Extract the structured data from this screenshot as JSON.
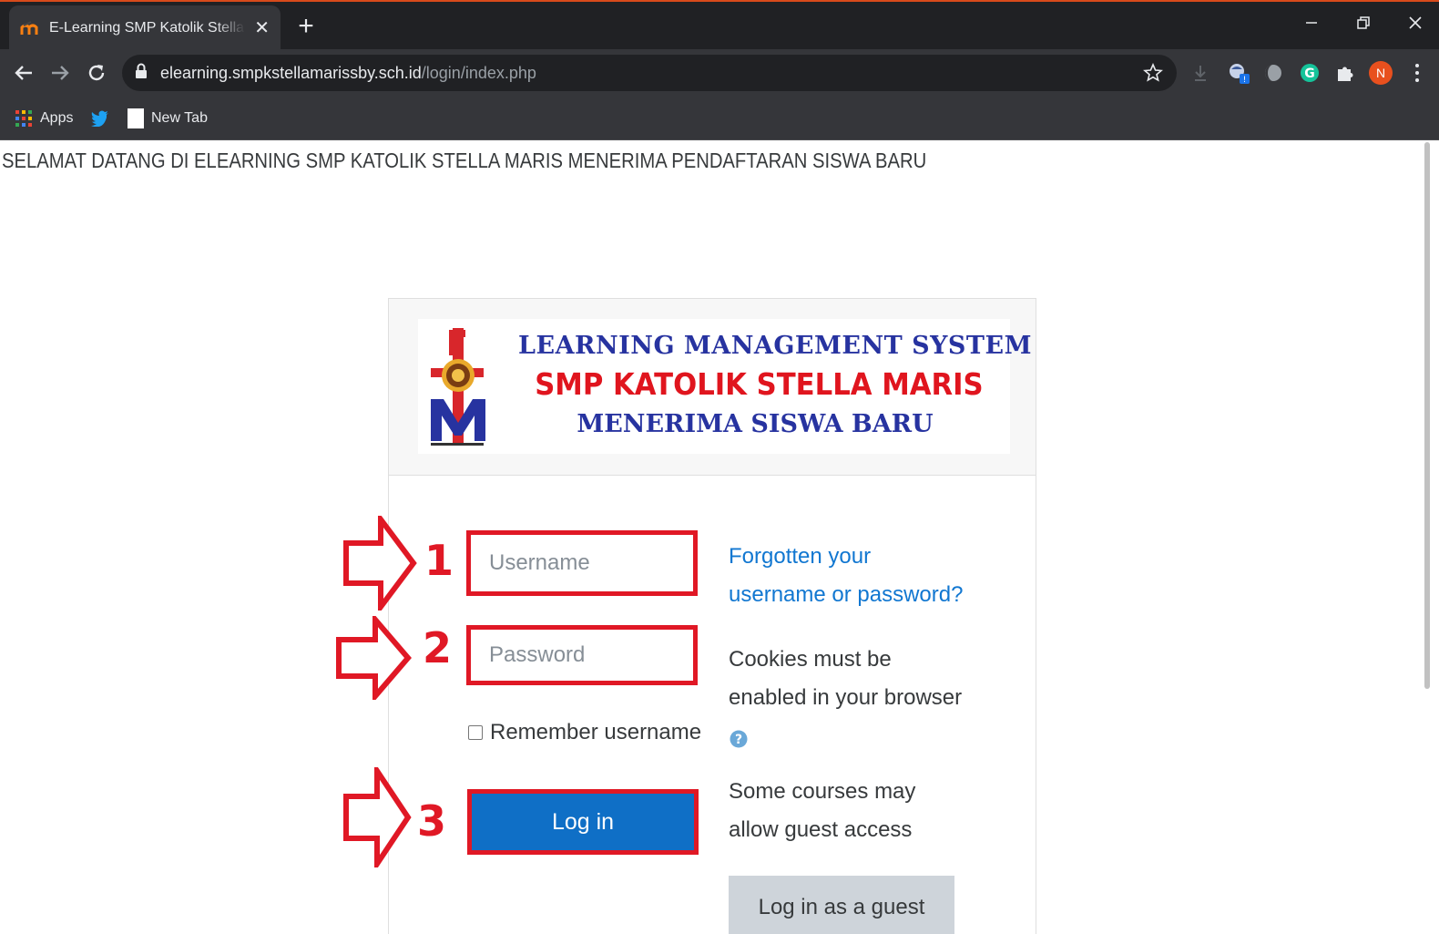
{
  "browser": {
    "tab_title": "E-Learning SMP Katolik Stella Maris",
    "tab_close": "✕",
    "new_tab": "+",
    "url_host": "elearning.smpkstellamarissby.sch.id",
    "url_path": "/login/index.php",
    "bookmarks": [
      {
        "label": "Apps",
        "icon": "apps-grid-icon"
      },
      {
        "label": "",
        "icon": "twitter-icon"
      },
      {
        "label": "New Tab",
        "icon": "page-icon"
      }
    ],
    "profile_initial": "N",
    "colors": {
      "frame": "#202124",
      "toolbar": "#35363a",
      "accent": "#d84a1b"
    }
  },
  "page": {
    "welcome_text": "SELAMAT DATANG DI ELEARNING SMP KATOLIK STELLA MARIS MENERIMA PENDAFTARAN SISWA BARU"
  },
  "banner": {
    "line1": "LEARNING MANAGEMENT SYSTEM",
    "line2": "SMP KATOLIK STELLA MARIS",
    "line3": "MENERIMA SISWA BARU",
    "colors": {
      "blue": "#2733a0",
      "red": "#e0151e"
    }
  },
  "login": {
    "username_placeholder": "Username",
    "password_placeholder": "Password",
    "remember_label": "Remember username",
    "login_button": "Log in",
    "forgot_line1": "Forgotten your",
    "forgot_line2": "username or password?",
    "cookies_line1": "Cookies must be",
    "cookies_line2": "enabled in your browser",
    "guest_line1": "Some courses may",
    "guest_line2": "allow guest access",
    "guest_button": "Log in as a guest",
    "colors": {
      "primary": "#0f6fc6",
      "link": "#1177d1",
      "highlight": "#e01825"
    }
  },
  "annotations": {
    "step1": "1",
    "step2": "2",
    "step3": "3"
  }
}
